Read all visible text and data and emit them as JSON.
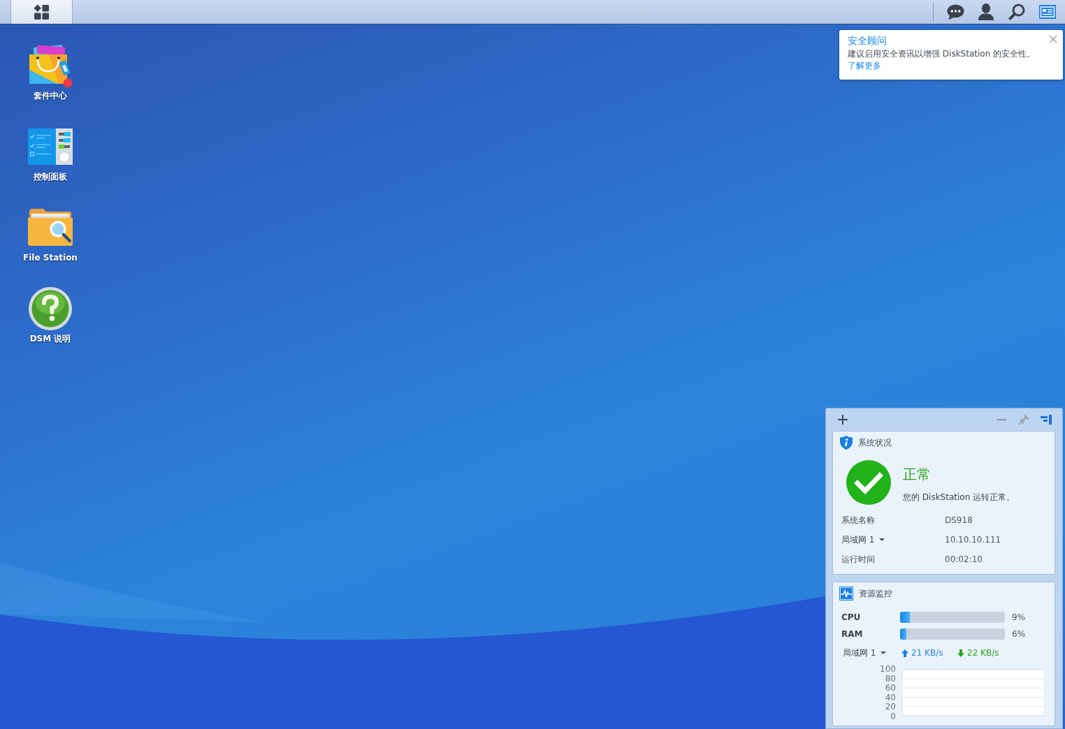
{
  "taskbar": {
    "buttons": [
      {
        "kind": "messages",
        "on": false
      },
      {
        "kind": "user",
        "on": false
      },
      {
        "kind": "search",
        "on": false
      },
      {
        "kind": "widgets",
        "on": true
      }
    ]
  },
  "desktop": {
    "shortcuts": [
      {
        "kind": "package_center",
        "label": "套件中心"
      },
      {
        "kind": "control_panel",
        "label": "控制面板"
      },
      {
        "kind": "file_station",
        "label": "File Station"
      },
      {
        "kind": "help",
        "label": "DSM 说明"
      }
    ]
  },
  "notification": {
    "title": "安全顾问",
    "text": "建议启用安全资讯以增强 DiskStation 的安全性。",
    "link": "了解更多"
  },
  "widgets": {
    "system_status": {
      "title": "系统状况",
      "status": "正常",
      "message": "您的 DiskStation 运转正常。",
      "rows": [
        {
          "kind": "text",
          "label": "系统名称",
          "value": "DS918"
        },
        {
          "kind": "dropdown",
          "label": "局域网 1",
          "value": "10.10.10.111"
        },
        {
          "kind": "text",
          "label": "运行时间",
          "value": "00:02:10"
        }
      ]
    },
    "resource_monitor": {
      "title": "资源监控",
      "meters": [
        {
          "label": "CPU",
          "level": 0.09,
          "reading": "9%"
        },
        {
          "label": "RAM",
          "level": 0.06,
          "reading": "6%"
        }
      ],
      "network": {
        "label": "局域网 1",
        "upload": "21 KB/s",
        "download": "22 KB/s"
      },
      "chart": {
        "y_labels": [
          "100",
          "80",
          "60",
          "40",
          "20",
          "0"
        ]
      }
    }
  }
}
